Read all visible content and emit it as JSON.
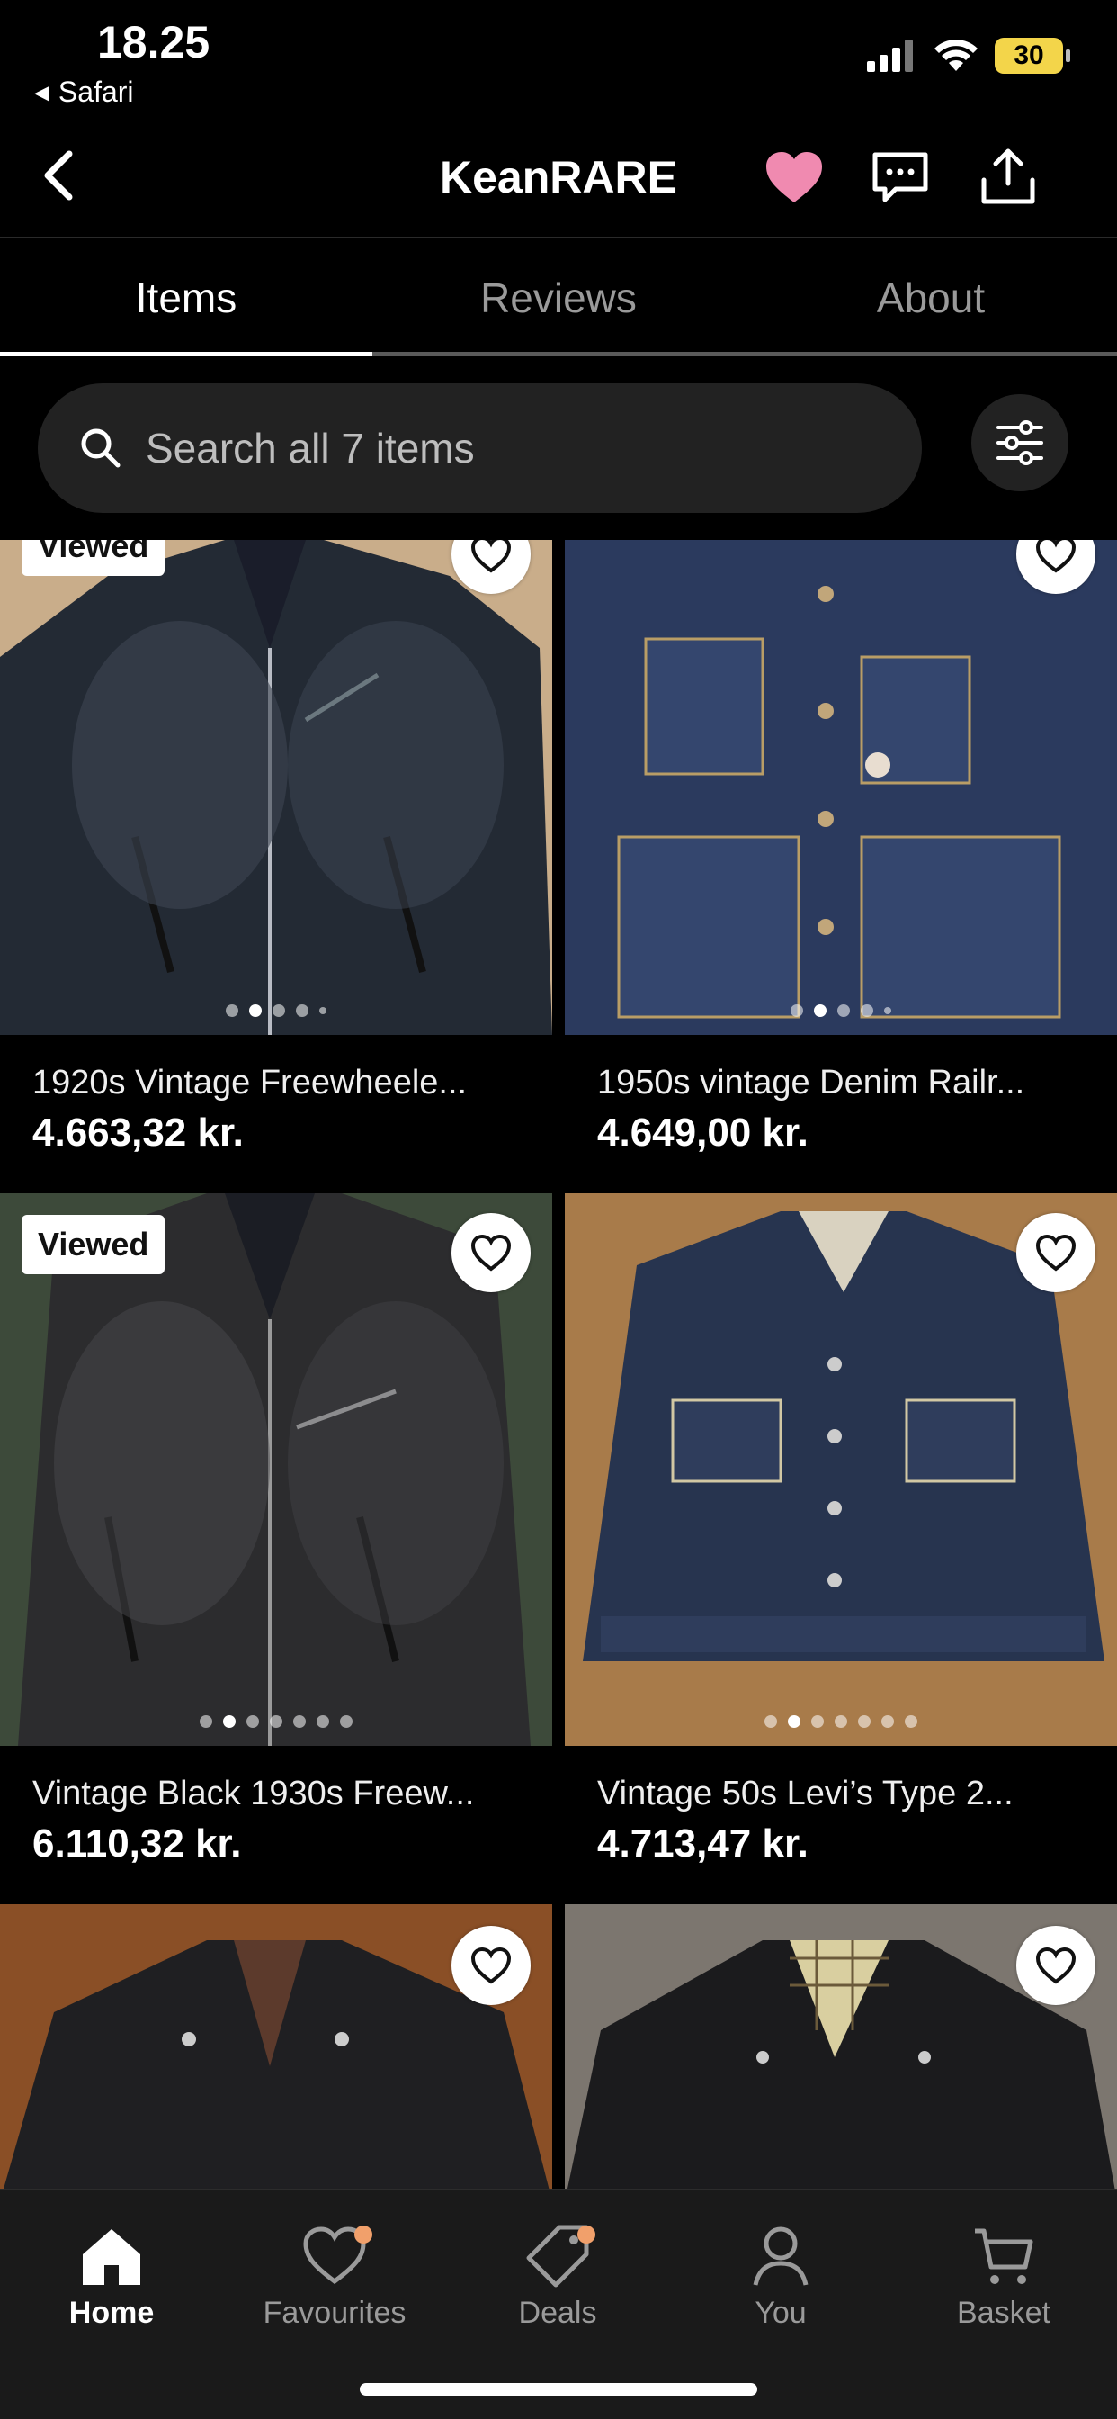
{
  "status": {
    "time": "18.25",
    "back_app": "Safari",
    "battery": "30"
  },
  "header": {
    "title": "KeanRARE"
  },
  "tabs": [
    {
      "label": "Items",
      "active": true
    },
    {
      "label": "Reviews",
      "active": false
    },
    {
      "label": "About",
      "active": false
    }
  ],
  "search": {
    "placeholder": "Search all 7 items"
  },
  "items": [
    {
      "title": "1920s Vintage Freewheele...",
      "price": "4.663,32 kr.",
      "viewed_label": "Viewed"
    },
    {
      "title": "1950s vintage Denim Railr...",
      "price": "4.649,00 kr."
    },
    {
      "title": "Vintage Black 1930s Freew...",
      "price": "6.110,32 kr.",
      "viewed_label": "Viewed"
    },
    {
      "title": "Vintage 50s Levi’s Type 2...",
      "price": "4.713,47 kr."
    },
    {
      "title": "",
      "price": ""
    },
    {
      "title": "",
      "price": ""
    }
  ],
  "nav": [
    {
      "label": "Home",
      "icon": "home-icon",
      "active": true
    },
    {
      "label": "Favourites",
      "icon": "heart-icon",
      "badge": true
    },
    {
      "label": "Deals",
      "icon": "tag-icon",
      "badge": true
    },
    {
      "label": "You",
      "icon": "person-icon"
    },
    {
      "label": "Basket",
      "icon": "cart-icon"
    }
  ],
  "colors": {
    "favourite_pink": "#f08ab0",
    "badge_orange": "#f1a06b",
    "battery_yellow": "#f3d54a"
  }
}
